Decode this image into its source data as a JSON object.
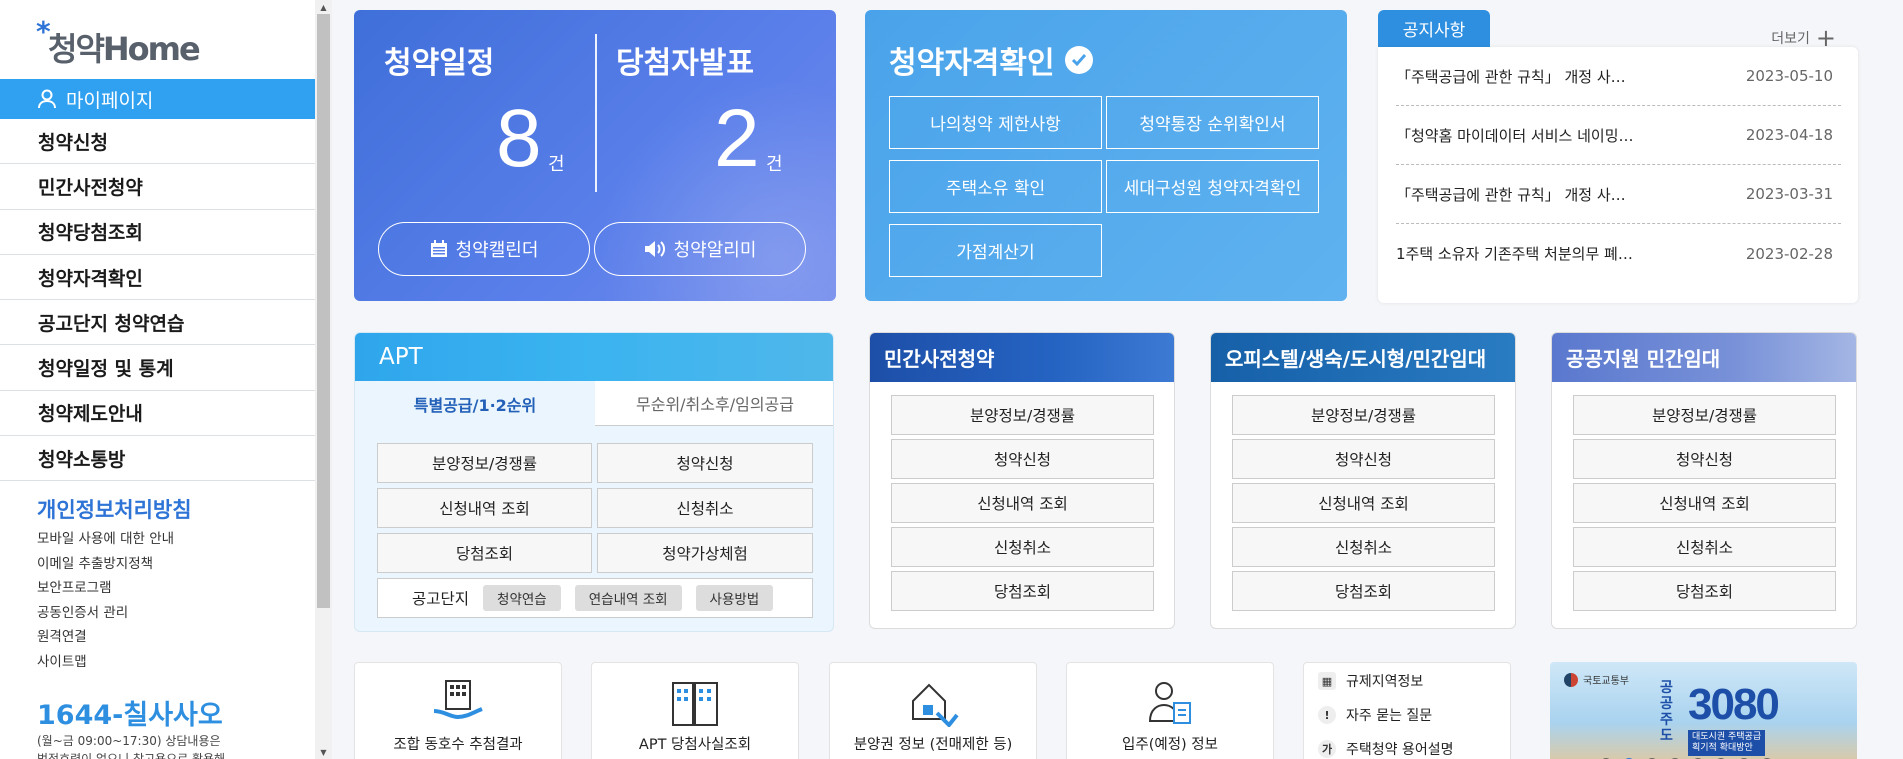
{
  "sidebar": {
    "logo_text": "청약Home",
    "mypage_label": "마이페이지",
    "menu": [
      "청약신청",
      "민간사전청약",
      "청약당첨조회",
      "청약자격확인",
      "공고단지 청약연습",
      "청약일정 및 통계",
      "청약제도안내",
      "청약소통방"
    ],
    "privacy_title": "개인정보처리방침",
    "links": [
      "모바일 사용에 대한 안내",
      "이메일 추출방지정책",
      "보안프로그램",
      "공동인증서 관리",
      "원격연결",
      "사이트맵"
    ],
    "phone": "1644-칠사사오",
    "hours_line1": "(월~금 09:00~17:30) 상담내용은",
    "hours_line2": "법적효력이 없으니 참고용으로 활용해"
  },
  "schedule_card": {
    "title1": "청약일정",
    "count1": "8",
    "unit1": "건",
    "title2": "당첨자발표",
    "count2": "2",
    "unit2": "건",
    "btn_calendar": "청약캘린더",
    "btn_alarm": "청약알리미"
  },
  "qual_card": {
    "title": "청약자격확인",
    "buttons": [
      "나의청약 제한사항",
      "청약통장 순위확인서",
      "주택소유 확인",
      "세대구성원 청약자격확인",
      "가점계산기"
    ]
  },
  "notice": {
    "tab": "공지사항",
    "more": "더보기",
    "items": [
      {
        "title": "「주택공급에 관한 규칙」 개정 사…",
        "date": "2023-05-10"
      },
      {
        "title": "「청약홈 마이데이터 서비스 네이밍…",
        "date": "2023-04-18"
      },
      {
        "title": "「주택공급에 관한 규칙」 개정 사…",
        "date": "2023-03-31"
      },
      {
        "title": "1주택 소유자 기존주택 처분의무 폐…",
        "date": "2023-02-28"
      }
    ]
  },
  "apt": {
    "title": "APT",
    "tab_active": "특별공급/1·2순위",
    "tab_inactive": "무순위/취소후/임의공급",
    "buttons": [
      "분양정보/경쟁률",
      "청약신청",
      "신청내역 조회",
      "신청취소",
      "당첨조회",
      "청약가상체험"
    ],
    "gong_label": "공고단지",
    "gong_tags": [
      "청약연습",
      "연습내역 조회",
      "사용방법"
    ]
  },
  "panels": [
    {
      "title": "민간사전청약",
      "buttons": [
        "분양정보/경쟁률",
        "청약신청",
        "신청내역 조회",
        "신청취소",
        "당첨조회"
      ]
    },
    {
      "title": "오피스텔/생숙/도시형/민간임대",
      "buttons": [
        "분양정보/경쟁률",
        "청약신청",
        "신청내역 조회",
        "신청취소",
        "당첨조회"
      ]
    },
    {
      "title": "공공지원 민간임대",
      "buttons": [
        "분양정보/경쟁률",
        "청약신청",
        "신청내역 조회",
        "신청취소",
        "당첨조회"
      ]
    }
  ],
  "icon_cards": [
    "조합 동호수 추첨결과",
    "APT 당첨사실조회",
    "분양권 정보 (전매제한 등)",
    "입주(예정) 정보"
  ],
  "quick_links": [
    "규제지역정보",
    "자주 묻는 질문",
    "주택청약 용어설명"
  ],
  "banner": {
    "gov": "국토교통부",
    "vertical": "공공주도",
    "number": "3080",
    "caption1": "대도시권 주택공급",
    "caption2": "획기적 확대방안"
  }
}
